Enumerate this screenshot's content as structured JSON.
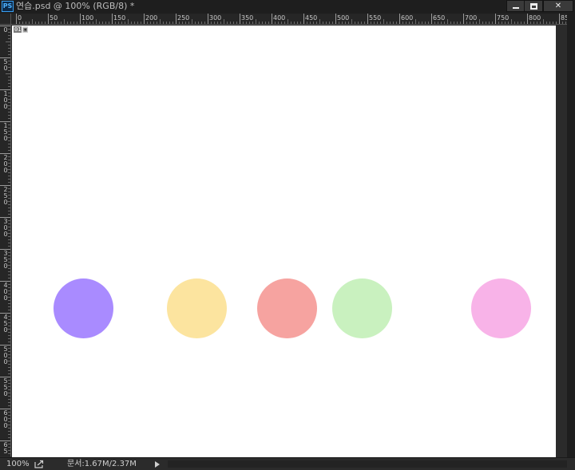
{
  "window": {
    "app_icon": "PS",
    "title": "연습.psd @ 100% (RGB/8) *",
    "minimize_label": "",
    "maximize_label": "",
    "close_label": "✕"
  },
  "rulers": {
    "horizontal_labels": [
      "0",
      "50",
      "100",
      "150",
      "200",
      "250",
      "300",
      "350",
      "400",
      "450",
      "500",
      "550",
      "600",
      "650",
      "700",
      "750",
      "800",
      "85"
    ],
    "vertical_labels": [
      "0",
      "50",
      "100",
      "150",
      "200",
      "250",
      "300",
      "350",
      "400",
      "450",
      "500",
      "550",
      "600",
      "65"
    ]
  },
  "canvas": {
    "slice_number": "01",
    "slice_icon": "slice-icon",
    "background_color": "#ffffff",
    "circles": [
      {
        "name": "purple-circle",
        "color": "#a98bff"
      },
      {
        "name": "yellow-circle",
        "color": "#fce49f"
      },
      {
        "name": "red-circle",
        "color": "#f6a3a0"
      },
      {
        "name": "green-circle",
        "color": "#c9f1bf"
      },
      {
        "name": "pink-circle",
        "color": "#f8b3e8"
      }
    ]
  },
  "statusbar": {
    "zoom": "100%",
    "doc_info": "문서:1.67M/2.37M",
    "share_icon": "export-icon",
    "arrow_icon": "play-arrow-icon"
  }
}
